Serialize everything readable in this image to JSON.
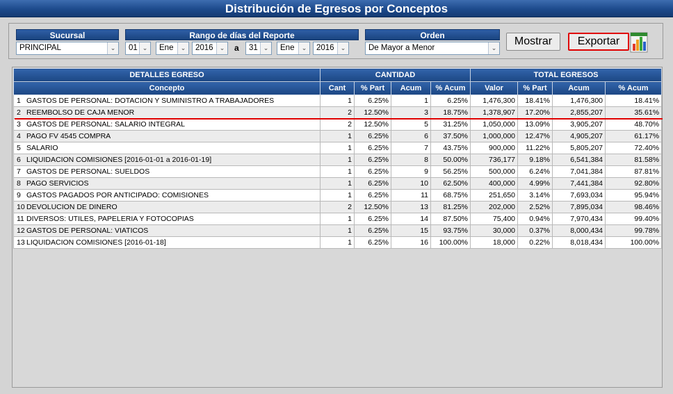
{
  "title": "Distribución de Egresos por Conceptos",
  "filters": {
    "sucursal_label": "Sucursal",
    "sucursal_value": "PRINCIPAL",
    "rango_label": "Rango de días del Reporte",
    "from_day": "01",
    "from_month": "Ene",
    "from_year": "2016",
    "sep": "a",
    "to_day": "31",
    "to_month": "Ene",
    "to_year": "2016",
    "orden_label": "Orden",
    "orden_value": "De Mayor a Menor",
    "dropdown_icon": "chevron-down-icon"
  },
  "buttons": {
    "mostrar": "Mostrar",
    "exportar": "Exportar",
    "export_icon": "excel-chart-icon"
  },
  "table": {
    "group_headers": {
      "detalles": "DETALLES EGRESO",
      "cantidad": "CANTIDAD",
      "total": "TOTAL EGRESOS"
    },
    "columns": [
      "Concepto",
      "Cant",
      "% Part",
      "Acum",
      "% Acum",
      "Valor",
      "% Part",
      "Acum",
      "% Acum"
    ],
    "rows": [
      [
        "1",
        "GASTOS DE PERSONAL: DOTACION Y SUMINISTRO A TRABAJADORES",
        "1",
        "6.25%",
        "1",
        "6.25%",
        "1,476,300",
        "18.41%",
        "1,476,300",
        "18.41%"
      ],
      [
        "2",
        "REEMBOLSO DE CAJA MENOR",
        "2",
        "12.50%",
        "3",
        "18.75%",
        "1,378,907",
        "17.20%",
        "2,855,207",
        "35.61%"
      ],
      [
        "3",
        "GASTOS DE PERSONAL: SALARIO INTEGRAL",
        "2",
        "12.50%",
        "5",
        "31.25%",
        "1,050,000",
        "13.09%",
        "3,905,207",
        "48.70%"
      ],
      [
        "4",
        "PAGO FV 4545 COMPRA",
        "1",
        "6.25%",
        "6",
        "37.50%",
        "1,000,000",
        "12.47%",
        "4,905,207",
        "61.17%"
      ],
      [
        "5",
        "SALARIO",
        "1",
        "6.25%",
        "7",
        "43.75%",
        "900,000",
        "11.22%",
        "5,805,207",
        "72.40%"
      ],
      [
        "6",
        "LIQUIDACION COMISIONES [2016-01-01 a 2016-01-19]",
        "1",
        "6.25%",
        "8",
        "50.00%",
        "736,177",
        "9.18%",
        "6,541,384",
        "81.58%"
      ],
      [
        "7",
        "GASTOS DE PERSONAL: SUELDOS",
        "1",
        "6.25%",
        "9",
        "56.25%",
        "500,000",
        "6.24%",
        "7,041,384",
        "87.81%"
      ],
      [
        "8",
        "PAGO SERVICIOS",
        "1",
        "6.25%",
        "10",
        "62.50%",
        "400,000",
        "4.99%",
        "7,441,384",
        "92.80%"
      ],
      [
        "9",
        "GASTOS PAGADOS POR ANTICIPADO: COMISIONES",
        "1",
        "6.25%",
        "11",
        "68.75%",
        "251,650",
        "3.14%",
        "7,693,034",
        "95.94%"
      ],
      [
        "10",
        "DEVOLUCION DE DINERO",
        "2",
        "12.50%",
        "13",
        "81.25%",
        "202,000",
        "2.52%",
        "7,895,034",
        "98.46%"
      ],
      [
        "11",
        "DIVERSOS: UTILES, PAPELERIA Y FOTOCOPIAS",
        "1",
        "6.25%",
        "14",
        "87.50%",
        "75,400",
        "0.94%",
        "7,970,434",
        "99.40%"
      ],
      [
        "12",
        "GASTOS DE PERSONAL: VIATICOS",
        "1",
        "6.25%",
        "15",
        "93.75%",
        "30,000",
        "0.37%",
        "8,000,434",
        "99.78%"
      ],
      [
        "13",
        "LIQUIDACION COMISIONES [2016-01-18]",
        "1",
        "6.25%",
        "16",
        "100.00%",
        "18,000",
        "0.22%",
        "8,018,434",
        "100.00%"
      ]
    ]
  },
  "colors": {
    "header_blue": "#1d4a8c",
    "highlight_red": "#e00000"
  }
}
